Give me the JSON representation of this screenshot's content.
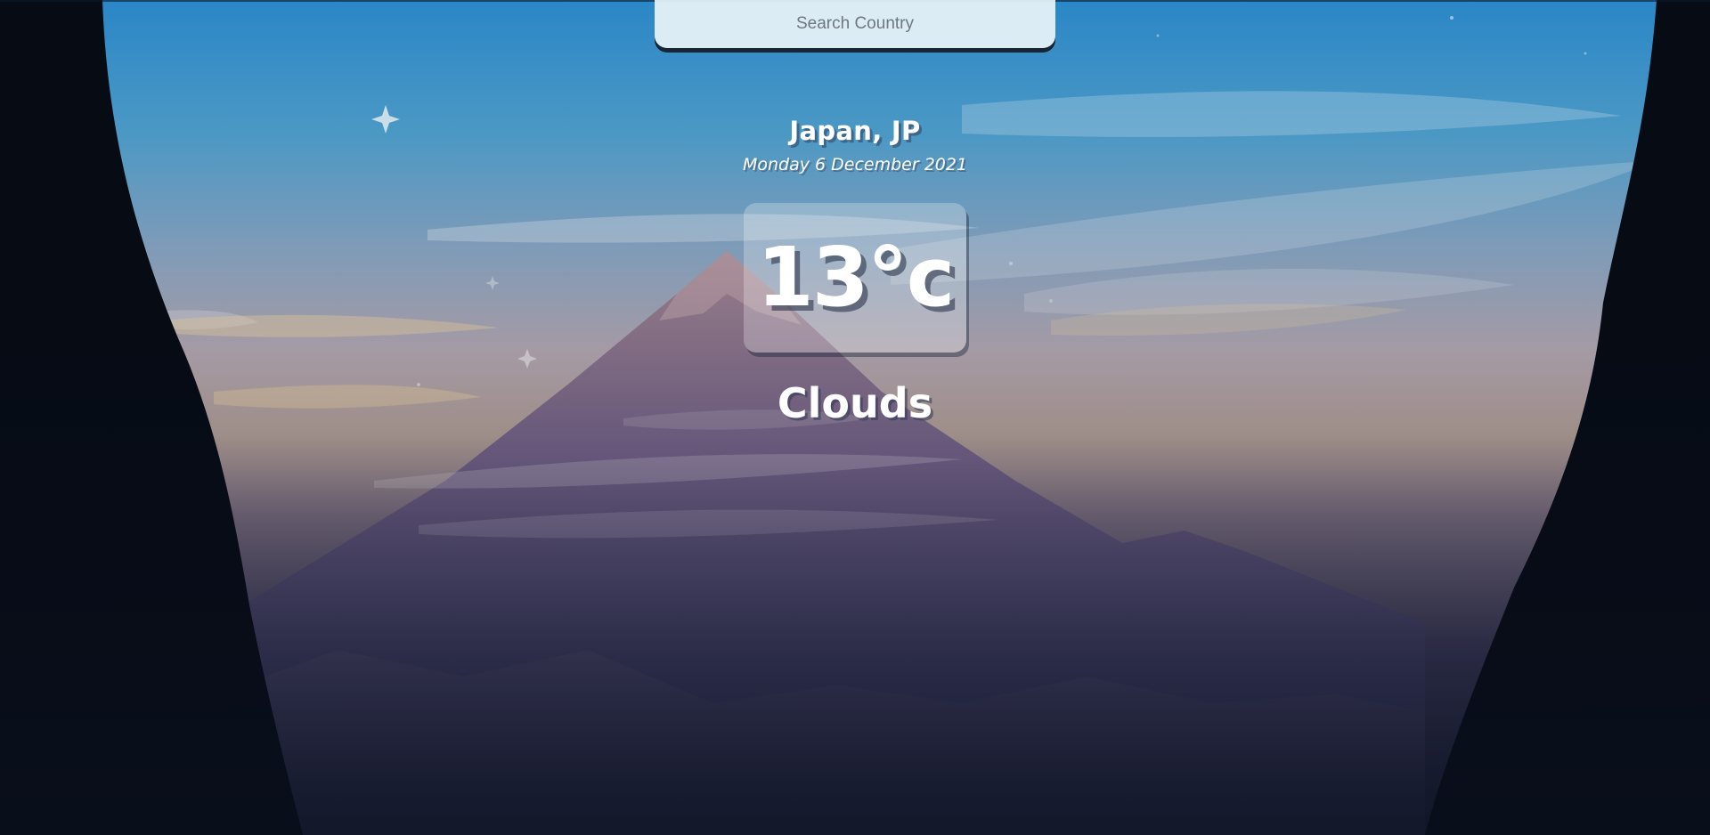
{
  "search": {
    "placeholder": "Search Country",
    "value": ""
  },
  "location": {
    "name": "Japan, JP",
    "date": "Monday 6 December 2021"
  },
  "weather": {
    "temperature": "13°c",
    "condition": "Clouds"
  },
  "colors": {
    "sky_top": "#2e8fcf",
    "sky_horizon": "#c9b5a4",
    "mountain": "#6b5d86",
    "cliffs": "#060b14",
    "search_background": "#e8f3f9"
  }
}
